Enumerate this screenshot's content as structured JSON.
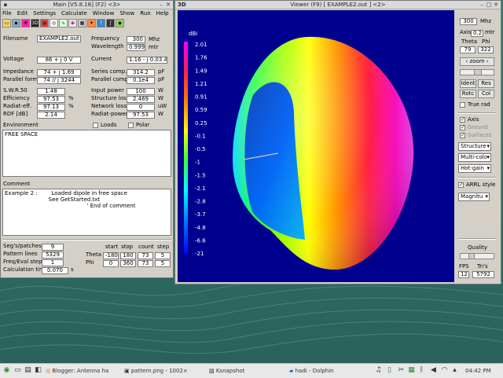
{
  "main": {
    "title": "Main [V5.8.16]  (F2)  <3>",
    "menu": [
      "File",
      "Edit",
      "Settings",
      "Calculate",
      "Window",
      "Show",
      "Run",
      "Help"
    ],
    "fields": {
      "filename_label": "Filename",
      "filename": "EXAMPLE2.out",
      "frequency_label": "Frequency",
      "frequency": "300",
      "frequency_unit": "Mhz",
      "wavelength_label": "Wavelength",
      "wavelength": "0.999",
      "wavelength_unit": "mtr",
      "voltage_label": "Voltage",
      "voltage": "86 + j 0 V",
      "current_label": "Current",
      "current": "1.16 - j 0.03 A",
      "impedance_label": "Impedance",
      "impedance": "74 + j 1.69",
      "series_comp_label": "Series comp.",
      "series_comp": "314.2",
      "series_comp_unit": "pF",
      "parallel_form_label": "Parallel form",
      "parallel_form": "74 // j 3244",
      "parallel_comp_label": "Parallel comp.",
      "parallel_comp": "0.1e4",
      "parallel_comp_unit": "pF",
      "swr_label": "S.W.R.50",
      "swr": "1.48",
      "input_power_label": "Input power",
      "input_power": "100",
      "input_power_unit": "W",
      "efficiency_label": "Efficiency",
      "efficiency": "97.53",
      "efficiency_unit": "%",
      "structure_loss_label": "Structure loss",
      "structure_loss": "2.469",
      "structure_loss_unit": "W",
      "radiat_eff_label": "Radiat-eff.",
      "radiat_eff": "97.13",
      "radiat_eff_unit": "%",
      "network_loss_label": "Network loss",
      "network_loss": "0",
      "network_loss_unit": "uW",
      "rdf_label": "RDF [dB]",
      "rdf": "2.14",
      "radiat_power_label": "Radiat-power",
      "radiat_power": "97.53",
      "radiat_power_unit": "W"
    },
    "environment_label": "Environment",
    "loads_label": "Loads",
    "polar_label": "Polar",
    "environment_text": "FREE SPACE",
    "comment_label": "Comment",
    "comment_text": "Example 2 :        Loaded dipole in free space\n                         See GetStarted.txt\n                                               ' End of comment",
    "bottom": {
      "segs_label": "Seg's/patches",
      "segs": "9",
      "pattern_label": "Pattern lines",
      "pattern": "5329",
      "freq_label": "Freq/Eval steps",
      "freq": "1",
      "calc_label": "Calculation time",
      "calc": "0.070",
      "calc_unit": "s",
      "start_label": "start",
      "stop_label": "stop",
      "count_label": "count",
      "step_label": "step",
      "theta_label": "Theta",
      "theta_start": "-180",
      "theta_stop": "180",
      "theta_count": "73",
      "theta_step": "5",
      "phi_label": "Phi",
      "phi_start": "0",
      "phi_stop": "360",
      "phi_count": "73",
      "phi_step": "5"
    }
  },
  "viewer": {
    "tag": "3D",
    "title": "Viewer (F9)     [ EXAMPLE2.out ] <2>",
    "scale_unit": "dBi",
    "scale_values": [
      "2.01",
      "1.76",
      "1.49",
      "1.21",
      "0.91",
      "0.59",
      "0.25",
      "-0.1",
      "-0.5",
      "-1",
      "-1.5",
      "-2.1",
      "-2.8",
      "-3.7",
      "-4.8",
      "-6.6",
      "-21"
    ],
    "panel": {
      "freq": "300",
      "mhz": "Mhz",
      "axis_label": "Axis",
      "axis": "0.2",
      "axis_unit": "mtr",
      "theta_label": "Theta",
      "phi_label": "Phi",
      "theta": "79",
      "phi": "322",
      "zoom": "zoom",
      "ident": "Ident",
      "res": "Res",
      "rotc": "Rotc",
      "col": "Col",
      "truerad": "True rad",
      "axis_chk": "Axis",
      "ground_chk": "Ground",
      "surfaces_chk": "Surfaces",
      "structure_sel": "Structure",
      "multicolor_sel": "Multi-colo",
      "hotgain_sel": "Hot-gain",
      "arrl_label": "ARRL style",
      "magnitude_sel": "Magnitu",
      "quality_label": "Quality",
      "fps_label": "FPS",
      "tris_label": "Tri's",
      "fps": "12",
      "tris": "5792"
    },
    "colors": {
      "plot_bg": "#00008f"
    }
  },
  "taskbar": {
    "items": [
      "Blogger: Antenna ha",
      "pattern.png - 1002×",
      "Ksnapshot",
      "hadi - Dolphin"
    ],
    "time": "04:42 PM"
  }
}
